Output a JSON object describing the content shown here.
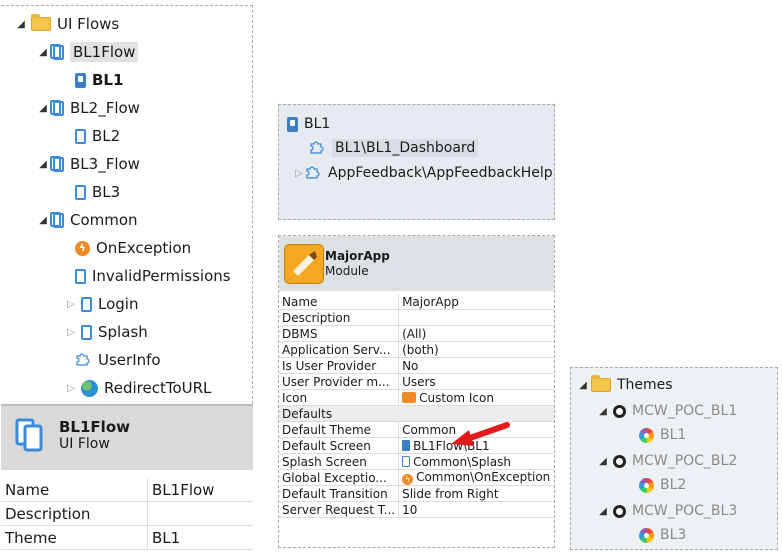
{
  "left_tree": {
    "root": "UI Flows",
    "flows": [
      {
        "name": "BL1Flow",
        "child": "BL1"
      },
      {
        "name": "BL2_Flow",
        "child": "BL2"
      },
      {
        "name": "BL3_Flow",
        "child": "BL3"
      }
    ],
    "common": {
      "name": "Common",
      "children": [
        "OnException",
        "InvalidPermissions",
        "Login",
        "Splash",
        "UserInfo",
        "RedirectToURL"
      ]
    }
  },
  "left_props": {
    "title": "BL1Flow",
    "subtitle": "UI Flow",
    "rows": [
      {
        "key": "Name",
        "value": "BL1Flow"
      },
      {
        "key": "Description",
        "value": ""
      },
      {
        "key": "Theme",
        "value": "BL1"
      }
    ]
  },
  "mid_tree": {
    "root": "BL1",
    "items": [
      "BL1\\BL1_Dashboard",
      "AppFeedback\\AppFeedbackHelp"
    ]
  },
  "mid_props": {
    "title": "MajorApp",
    "subtitle": "Module",
    "rows": [
      {
        "key": "Name",
        "value": "MajorApp"
      },
      {
        "key": "Description",
        "value": ""
      },
      {
        "key": "DBMS",
        "value": "(All)"
      },
      {
        "key": "Application Serv...",
        "value": "(both)"
      },
      {
        "key": "Is User Provider",
        "value": "No"
      },
      {
        "key": "User Provider m...",
        "value": "Users"
      },
      {
        "key": "Icon",
        "value": "Custom Icon"
      }
    ],
    "category": "Defaults",
    "default_rows": [
      {
        "key": "Default Theme",
        "value": "Common"
      },
      {
        "key": "Default Screen",
        "value": "BL1Flow\\BL1"
      },
      {
        "key": "Splash Screen",
        "value": "Common\\Splash"
      },
      {
        "key": "Global Exceptio...",
        "value": "Common\\OnException"
      },
      {
        "key": "Default Transition",
        "value": "Slide from Right"
      },
      {
        "key": "Server Request T...",
        "value": "10"
      }
    ]
  },
  "themes": {
    "root": "Themes",
    "groups": [
      {
        "name": "MCW_POC_BL1",
        "child": "BL1"
      },
      {
        "name": "MCW_POC_BL2",
        "child": "BL2"
      },
      {
        "name": "MCW_POC_BL3",
        "child": "BL3"
      }
    ]
  },
  "colors": {
    "accent_blue": "#3d8bd6",
    "arrow_red": "#e31b1b",
    "folder_yellow": "#f3c54b",
    "exception_orange": "#f08a24"
  }
}
